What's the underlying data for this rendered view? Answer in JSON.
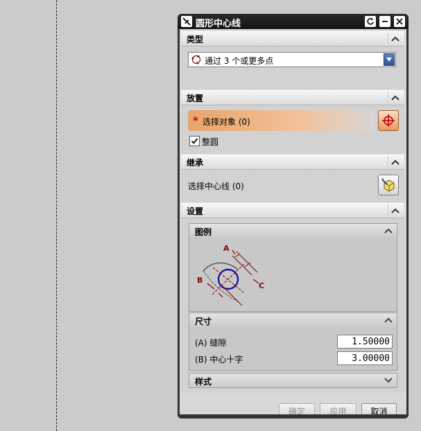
{
  "dialog": {
    "title": "圆形中心线"
  },
  "sections": {
    "type": {
      "label": "类型",
      "selected": "通过 3 个或更多点"
    },
    "placement": {
      "label": "放置",
      "select_label": "选择对象 (0)",
      "checkbox_label": "整圆",
      "checkbox_checked": true
    },
    "inherit": {
      "label": "继承",
      "select_label": "选择中心线 (0)"
    },
    "settings": {
      "label": "设置",
      "legend": {
        "label": "图例",
        "letters": {
          "a": "A",
          "b": "B",
          "c": "C"
        }
      },
      "dimensions": {
        "label": "尺寸",
        "gap_label": "(A) 缝隙",
        "gap_value": "1.50000",
        "cross_label": "(B) 中心十字",
        "cross_value": "3.00000"
      },
      "style": {
        "label": "样式"
      }
    }
  },
  "footer": {
    "ok": "确定",
    "apply": "应用",
    "cancel": "取消"
  },
  "colors": {
    "highlight": "#e8a46a",
    "legend_circle": "#1a1aa0",
    "legend_dim": "#8b0000"
  }
}
